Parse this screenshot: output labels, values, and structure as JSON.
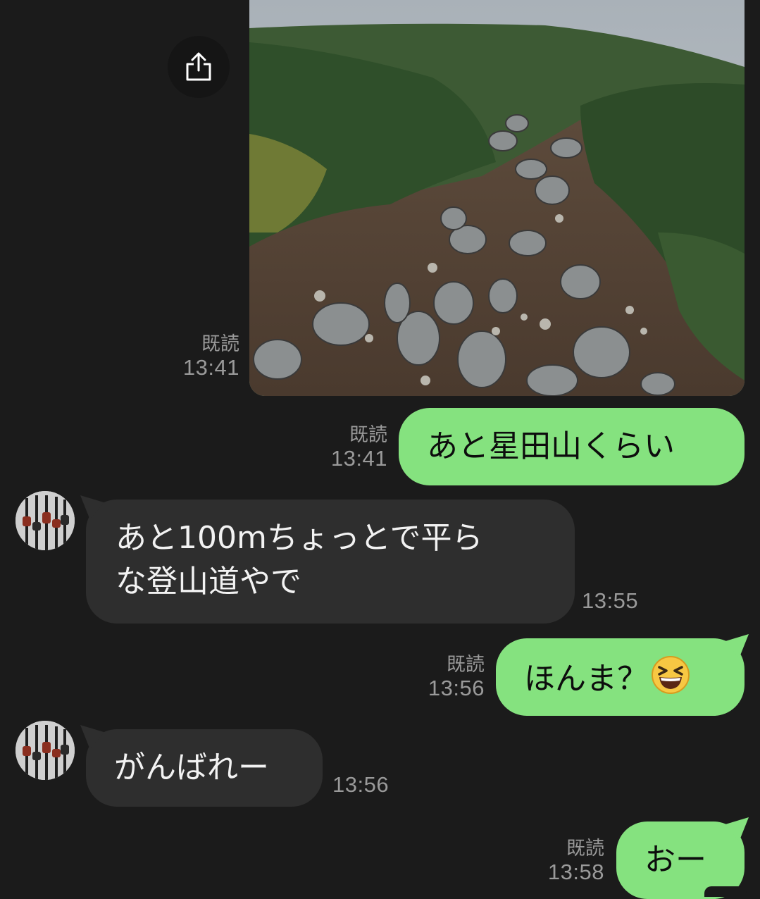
{
  "messages": [
    {
      "id": "photo",
      "direction": "out",
      "type": "image",
      "image_desc": "rocky mountain trail among dwarf pines in fog",
      "read_label": "既読",
      "time": "13:41"
    },
    {
      "id": "m1",
      "direction": "out",
      "text": "あと星田山くらい",
      "read_label": "既読",
      "time": "13:41"
    },
    {
      "id": "m2",
      "direction": "in",
      "text_lines": [
        "あと100mちょっとで平ら",
        "な登山道やで"
      ],
      "time": "13:55"
    },
    {
      "id": "m3",
      "direction": "out",
      "text": "ほんま？",
      "emoji": "grinning-squinting-face",
      "read_label": "既読",
      "time": "13:56"
    },
    {
      "id": "m4",
      "direction": "in",
      "text": "がんばれー",
      "time": "13:56"
    },
    {
      "id": "m5",
      "direction": "out",
      "text": "おー",
      "read_label": "既読",
      "time": "13:58"
    }
  ],
  "colors": {
    "background": "#1b1b1b",
    "outgoing_bubble": "#85e27f",
    "incoming_bubble": "#2e2e2e",
    "meta_text": "#9a9a9a"
  },
  "icons": {
    "share": "share-icon",
    "emoji": "grinning-squinting-face-icon"
  }
}
